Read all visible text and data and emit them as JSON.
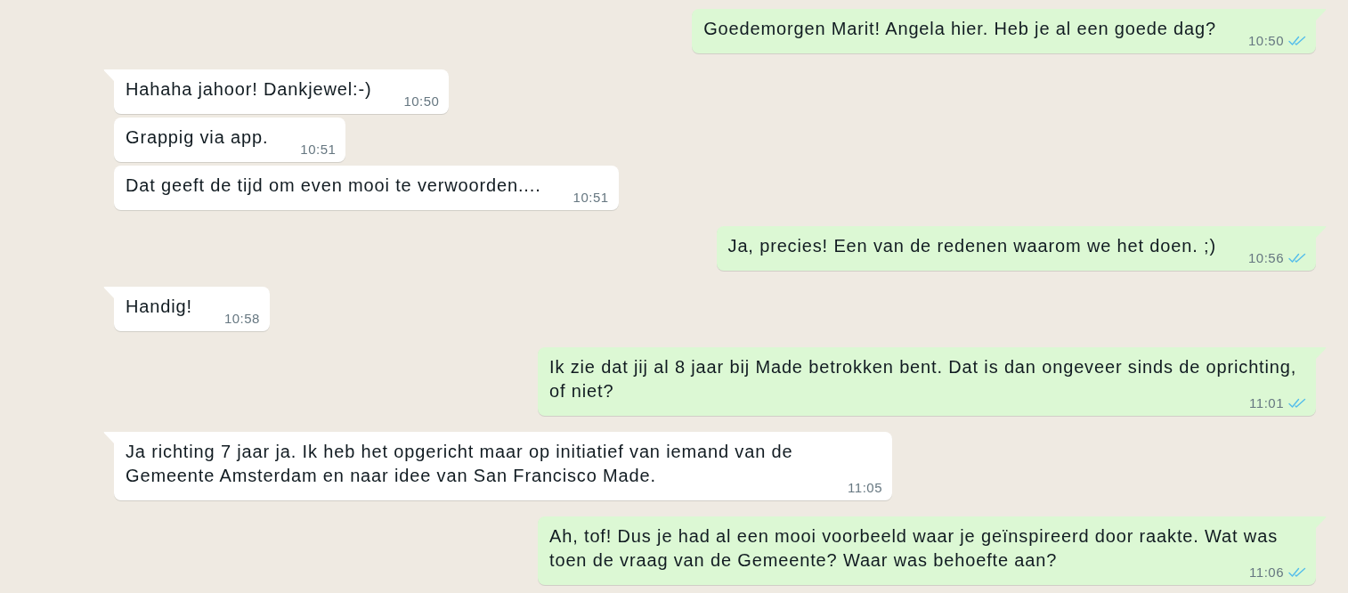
{
  "messages": [
    {
      "kind": "outgoing",
      "text": "Goedemorgen Marit! Angela hier. Heb je al een goede dag?",
      "time": "10:50",
      "tail": true,
      "read": true
    },
    {
      "kind": "incoming",
      "text": "Hahaha jahoor! Dankjewel:-)",
      "time": "10:50",
      "tail": true
    },
    {
      "kind": "incoming",
      "text": "Grappig via app.",
      "time": "10:51",
      "tail": false
    },
    {
      "kind": "incoming",
      "text": "Dat geeft de tijd om even mooi te verwoorden....",
      "time": "10:51",
      "tail": false
    },
    {
      "kind": "outgoing",
      "text": "Ja, precies! Een van de redenen waarom we het doen. ;)",
      "time": "10:56",
      "tail": true,
      "read": true
    },
    {
      "kind": "incoming",
      "text": "Handig!",
      "time": "10:58",
      "tail": true
    },
    {
      "kind": "outgoing",
      "text": "Ik zie dat jij al 8 jaar bij Made betrokken bent. Dat is dan ongeveer sinds de oprichting, of niet?",
      "time": "11:01",
      "tail": true,
      "read": true
    },
    {
      "kind": "incoming",
      "text": "Ja richting 7 jaar ja. Ik heb het opgericht maar op initiatief van iemand van de Gemeente Amsterdam en naar idee van San Francisco Made.",
      "time": "11:05",
      "tail": true
    },
    {
      "kind": "outgoing",
      "text": "Ah, tof! Dus je had al een mooi voorbeeld waar je geïnspireerd door raakte. Wat was toen de vraag van de Gemeente? Waar was behoefte aan?",
      "time": "11:06",
      "tail": true,
      "read": true
    }
  ]
}
